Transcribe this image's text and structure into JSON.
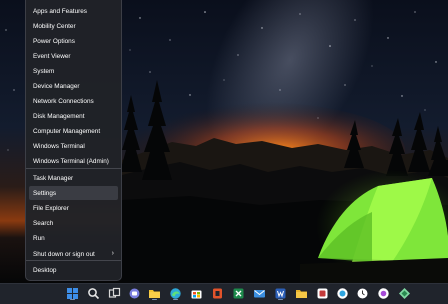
{
  "menu": {
    "items": [
      {
        "label": "Apps and Features"
      },
      {
        "label": "Mobility Center"
      },
      {
        "label": "Power Options"
      },
      {
        "label": "Event Viewer"
      },
      {
        "label": "System"
      },
      {
        "label": "Device Manager"
      },
      {
        "label": "Network Connections"
      },
      {
        "label": "Disk Management"
      },
      {
        "label": "Computer Management"
      },
      {
        "label": "Windows Terminal"
      },
      {
        "label": "Windows Terminal (Admin)"
      },
      {
        "label": "Task Manager"
      },
      {
        "label": "Settings",
        "selected": true
      },
      {
        "label": "File Explorer"
      },
      {
        "label": "Search"
      },
      {
        "label": "Run"
      },
      {
        "label": "Shut down or sign out",
        "has_submenu": true
      },
      {
        "label": "Desktop"
      }
    ],
    "submenu_glyph": "›"
  },
  "taskbar": {
    "icons": [
      {
        "name": "start-icon",
        "color": "#3d8ee8"
      },
      {
        "name": "search-icon",
        "color": "#e8e8e8"
      },
      {
        "name": "task-view-icon",
        "color": "#d8d8d8"
      },
      {
        "name": "chat-icon",
        "color": "#7b7fe0"
      },
      {
        "name": "file-explorer-icon",
        "color": "#f2c230"
      },
      {
        "name": "edge-icon",
        "color": "#2ea8d8"
      },
      {
        "name": "store-icon",
        "color": "#e8e8e8"
      },
      {
        "name": "office-icon",
        "color": "#e2532b"
      },
      {
        "name": "excel-icon",
        "color": "#1e8a4c"
      },
      {
        "name": "mail-icon",
        "color": "#3b8fe0"
      },
      {
        "name": "word-icon",
        "color": "#2b5fb8"
      },
      {
        "name": "folder-icon",
        "color": "#e8b32a"
      },
      {
        "name": "app-icon",
        "color": "#c33a3a"
      },
      {
        "name": "photos-icon",
        "color": "#2ea5e0"
      },
      {
        "name": "clock-icon",
        "color": "#e8e8e8"
      },
      {
        "name": "app-icon-2",
        "color": "#a64bd8"
      },
      {
        "name": "maps-icon",
        "color": "#7ed6a0"
      }
    ]
  },
  "colors": {
    "tent": "#7fe63a",
    "horizon_glow": "#e86a18",
    "menu_bg": "#202228",
    "selected_item": "#3a3c43"
  }
}
